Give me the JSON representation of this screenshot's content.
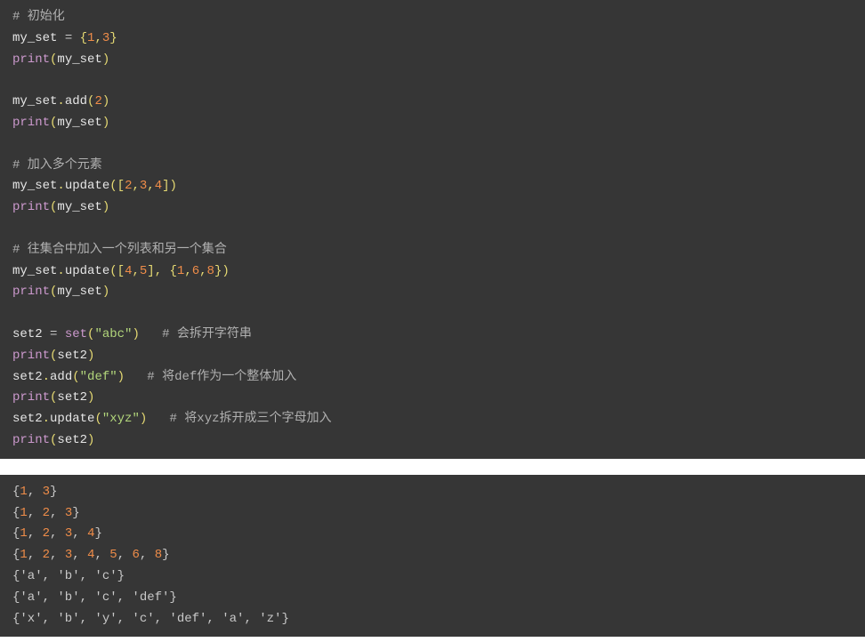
{
  "code": {
    "c1": "# 初始化",
    "l2_ident": "my_set",
    "l2_op": " = ",
    "l2_b1": "{",
    "l2_n1": "1",
    "l2_cm": ",",
    "l2_n2": "3",
    "l2_b2": "}",
    "l3_fn": "print",
    "l3_p1": "(",
    "l3_arg": "my_set",
    "l3_p2": ")",
    "l5_obj": "my_set",
    "l5_dot": ".",
    "l5_m": "add",
    "l5_p1": "(",
    "l5_n": "2",
    "l5_p2": ")",
    "l6_fn": "print",
    "l6_p1": "(",
    "l6_arg": "my_set",
    "l6_p2": ")",
    "c2": "# 加入多个元素",
    "l8_obj": "my_set",
    "l8_dot": ".",
    "l8_m": "update",
    "l8_p1": "(",
    "l8_b1": "[",
    "l8_n1": "2",
    "l8_cm1": ",",
    "l8_n2": "3",
    "l8_cm2": ",",
    "l8_n3": "4",
    "l8_b2": "]",
    "l8_p2": ")",
    "l9_fn": "print",
    "l9_p1": "(",
    "l9_arg": "my_set",
    "l9_p2": ")",
    "c3": "# 往集合中加入一个列表和另一个集合",
    "l11_obj": "my_set",
    "l11_dot": ".",
    "l11_m": "update",
    "l11_p1": "(",
    "l11_b1": "[",
    "l11_n1": "4",
    "l11_cm1": ",",
    "l11_n2": "5",
    "l11_b2": "]",
    "l11_cm2": ", ",
    "l11_b3": "{",
    "l11_n3": "1",
    "l11_cm3": ",",
    "l11_n4": "6",
    "l11_cm4": ",",
    "l11_n5": "8",
    "l11_b4": "}",
    "l11_p2": ")",
    "l12_fn": "print",
    "l12_p1": "(",
    "l12_arg": "my_set",
    "l12_p2": ")",
    "l14_ident": "set2",
    "l14_op": " = ",
    "l14_fn": "set",
    "l14_p1": "(",
    "l14_s": "\"abc\"",
    "l14_p2": ")",
    "l14_sp": "   ",
    "l14_c": "# 会拆开字符串",
    "l15_fn": "print",
    "l15_p1": "(",
    "l15_arg": "set2",
    "l15_p2": ")",
    "l16_obj": "set2",
    "l16_dot": ".",
    "l16_m": "add",
    "l16_p1": "(",
    "l16_s": "\"def\"",
    "l16_p2": ")",
    "l16_sp": "   ",
    "l16_c": "# 将def作为一个整体加入",
    "l17_fn": "print",
    "l17_p1": "(",
    "l17_arg": "set2",
    "l17_p2": ")",
    "l18_obj": "set2",
    "l18_dot": ".",
    "l18_m": "update",
    "l18_p1": "(",
    "l18_s": "\"xyz\"",
    "l18_p2": ")",
    "l18_sp": "   ",
    "l18_c": "# 将xyz拆开成三个字母加入",
    "l19_fn": "print",
    "l19_p1": "(",
    "l19_arg": "set2",
    "l19_p2": ")"
  },
  "output": {
    "o1_b1": "{",
    "o1_n1": "1",
    "o1_c1": ", ",
    "o1_n2": "3",
    "o1_b2": "}",
    "o2_b1": "{",
    "o2_n1": "1",
    "o2_c1": ", ",
    "o2_n2": "2",
    "o2_c2": ", ",
    "o2_n3": "3",
    "o2_b2": "}",
    "o3_b1": "{",
    "o3_n1": "1",
    "o3_c1": ", ",
    "o3_n2": "2",
    "o3_c2": ", ",
    "o3_n3": "3",
    "o3_c3": ", ",
    "o3_n4": "4",
    "o3_b2": "}",
    "o4_b1": "{",
    "o4_n1": "1",
    "o4_c1": ", ",
    "o4_n2": "2",
    "o4_c2": ", ",
    "o4_n3": "3",
    "o4_c3": ", ",
    "o4_n4": "4",
    "o4_c4": ", ",
    "o4_n5": "5",
    "o4_c5": ", ",
    "o4_n6": "6",
    "o4_c6": ", ",
    "o4_n7": "8",
    "o4_b2": "}",
    "o5": "{'a', 'b', 'c'}",
    "o6": "{'a', 'b', 'c', 'def'}",
    "o7": "{'x', 'b', 'y', 'c', 'def', 'a', 'z'}"
  }
}
